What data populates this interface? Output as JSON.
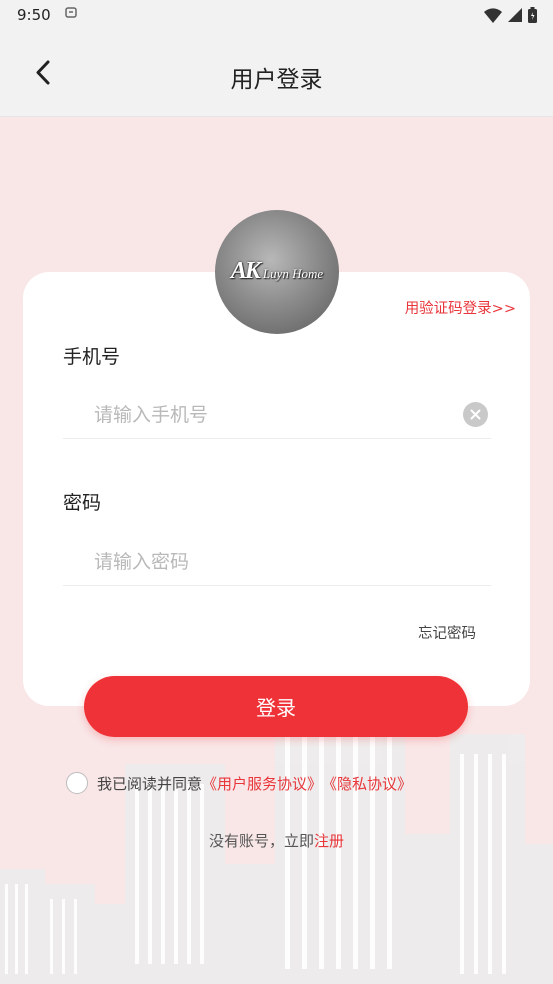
{
  "status_bar": {
    "time": "9:50"
  },
  "nav": {
    "title": "用户登录"
  },
  "avatar": {
    "logo_ak": "AK",
    "logo_text": "Luyn Home"
  },
  "card": {
    "sms_login_link": "用验证码登录>>",
    "phone": {
      "label": "手机号",
      "placeholder": "请输入手机号",
      "value": ""
    },
    "password": {
      "label": "密码",
      "placeholder": "请输入密码",
      "value": ""
    },
    "forgot_label": "忘记密码"
  },
  "login_button": "登录",
  "agreement": {
    "checked": false,
    "prefix": "我已阅读并同意",
    "terms_link": "《用户服务协议》",
    "privacy_link": "《隐私协议》"
  },
  "register": {
    "prefix": "没有账号，立即",
    "link": "注册"
  },
  "colors": {
    "accent": "#ef3237",
    "page_bg": "#f9e6e7",
    "nav_bg": "#f2f2f2"
  }
}
